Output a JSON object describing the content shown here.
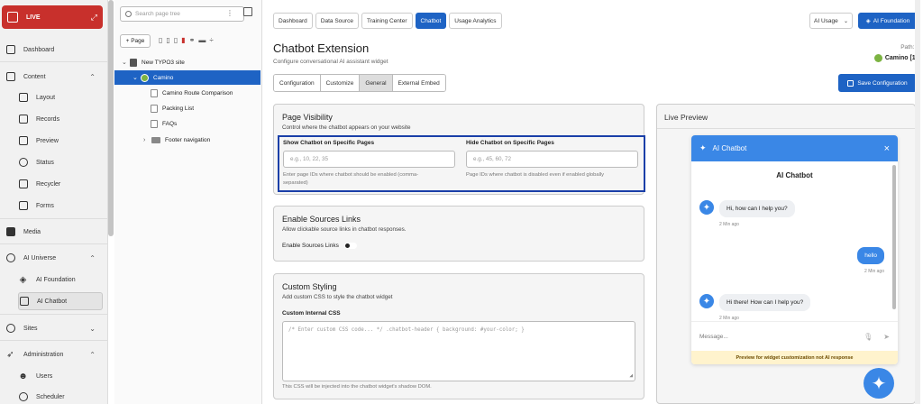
{
  "sidebar": {
    "live_label": "LIVE",
    "items": [
      {
        "label": "Dashboard"
      },
      {
        "label": "Content"
      },
      {
        "label": "Layout"
      },
      {
        "label": "Records"
      },
      {
        "label": "Preview"
      },
      {
        "label": "Status"
      },
      {
        "label": "Recycler"
      },
      {
        "label": "Forms"
      },
      {
        "label": "Media"
      },
      {
        "label": "AI Universe"
      },
      {
        "label": "AI Foundation"
      },
      {
        "label": "AI Chatbot"
      },
      {
        "label": "Sites"
      },
      {
        "label": "Administration"
      },
      {
        "label": "Users"
      },
      {
        "label": "Scheduler"
      }
    ]
  },
  "tree": {
    "search_placeholder": "Search page tree",
    "new_page_label": "+ Page",
    "nodes": [
      {
        "label": "New TYPO3 site"
      },
      {
        "label": "Camino"
      },
      {
        "label": "Camino Route Comparison"
      },
      {
        "label": "Packing List"
      },
      {
        "label": "FAQs"
      },
      {
        "label": "Footer navigation"
      }
    ]
  },
  "header": {
    "tabs": [
      "Dashboard",
      "Data Source",
      "Training Center",
      "Chatbot",
      "Usage Analytics"
    ],
    "usage_select": "AI Usage",
    "ai_foundation_button": "AI Foundation",
    "title": "Chatbot Extension",
    "subtitle": "Configure conversational AI assistant widget",
    "path_label": "Path: /",
    "path_value": "Camino [1]"
  },
  "subtabs": [
    "Configuration",
    "Customize",
    "General",
    "External Embed"
  ],
  "save_button": "Save Configuration",
  "page_visibility": {
    "title": "Page Visibility",
    "desc": "Control where the chatbot appears on your website",
    "show_label": "Show Chatbot on Specific Pages",
    "show_placeholder": "e.g., 10, 22, 35",
    "show_help": "Enter page IDs where chatbot should be enabled (comma-separated)",
    "hide_label": "Hide Chatbot on Specific Pages",
    "hide_placeholder": "e.g., 45, 60, 72",
    "hide_help": "Page IDs where chatbot is disabled even if enabled globally"
  },
  "sources": {
    "title": "Enable Sources Links",
    "desc": "Allow clickable source links in chatbot responses.",
    "toggle_label": "Enable Sources Links"
  },
  "styling": {
    "title": "Custom Styling",
    "desc": "Add custom CSS to style the chatbot widget",
    "label": "Custom Internal CSS",
    "placeholder": "/* Enter custom CSS code... */ .chatbot-header { background: #your-color; }",
    "help": "This CSS will be injected into the chatbot widget's shadow DOM."
  },
  "preview": {
    "title": "Live Preview",
    "widget_header": "AI Chatbot",
    "widget_title": "AI Chatbot",
    "messages": [
      {
        "text": "Hi, how can I help you?",
        "time": "2 Min ago"
      },
      {
        "text": "hello",
        "time": "2 Min ago"
      },
      {
        "text": "Hi there! How can I help you?",
        "time": "2 Min ago"
      }
    ],
    "input_placeholder": "Message...",
    "note": "Preview for widget customization not AI response"
  }
}
